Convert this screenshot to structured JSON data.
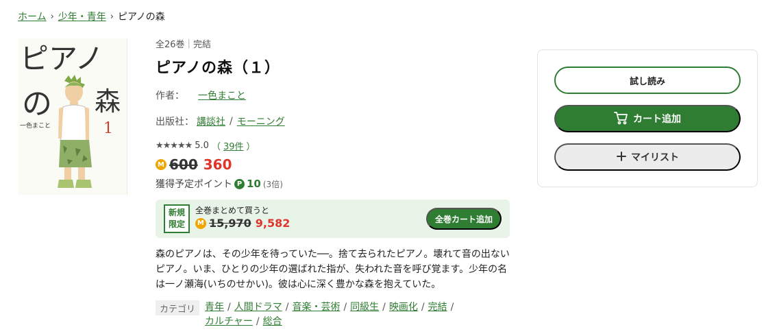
{
  "breadcrumb": {
    "home": "ホーム",
    "category": "少年・青年",
    "current": "ピアノの森"
  },
  "cover": {
    "title_line1": "ピアノ",
    "title_no": "の",
    "title_mori": "森",
    "author": "一色まこと",
    "volume": "1"
  },
  "book": {
    "volumes": "全26巻",
    "status": "完結",
    "title": "ピアノの森（１）",
    "author_label": "作者：",
    "author": "一色まこと",
    "publisher_label": "出版社：",
    "publisher": "講談社",
    "label": "モーニング",
    "stars": "★★★★★",
    "rating": "5.0",
    "review_count_open": "（",
    "review_count": "39件",
    "review_count_close": "）",
    "old_price": "600",
    "price": "360",
    "points_label": "獲得予定ポイント",
    "points": "10",
    "points_multiplier": "(3倍)"
  },
  "bundle": {
    "badge_line1": "新規",
    "badge_line2": "限定",
    "text": "全巻まとめて買うと",
    "old_price": "15,970",
    "price": "9,582",
    "button": "全巻カート追加"
  },
  "description": "森のピアノは、その少年を待っていた──。捨て去られたピアノ。壊れて音の出ないピアノ。いま、ひとりの少年の選ばれた指が、失われた音を呼び覚ます。少年の名は一ノ瀬海(いちのせかい)。彼は心に深く豊かな森を抱えていた。",
  "categories": {
    "label": "カテゴリ",
    "items": [
      "青年",
      "人間ドラマ",
      "音楽・芸術",
      "同級生",
      "映画化",
      "完結",
      "カルチャー",
      "総合"
    ]
  },
  "actions": {
    "try_read": "試し読み",
    "add_cart": "カート追加",
    "my_list": "マイリスト"
  },
  "icons": {
    "coin": "M",
    "point": "P",
    "cart": "cart-icon",
    "plus": "plus-icon"
  },
  "colors": {
    "accent": "#2f7d32",
    "price": "#e0352b",
    "coin": "#f0a500"
  }
}
